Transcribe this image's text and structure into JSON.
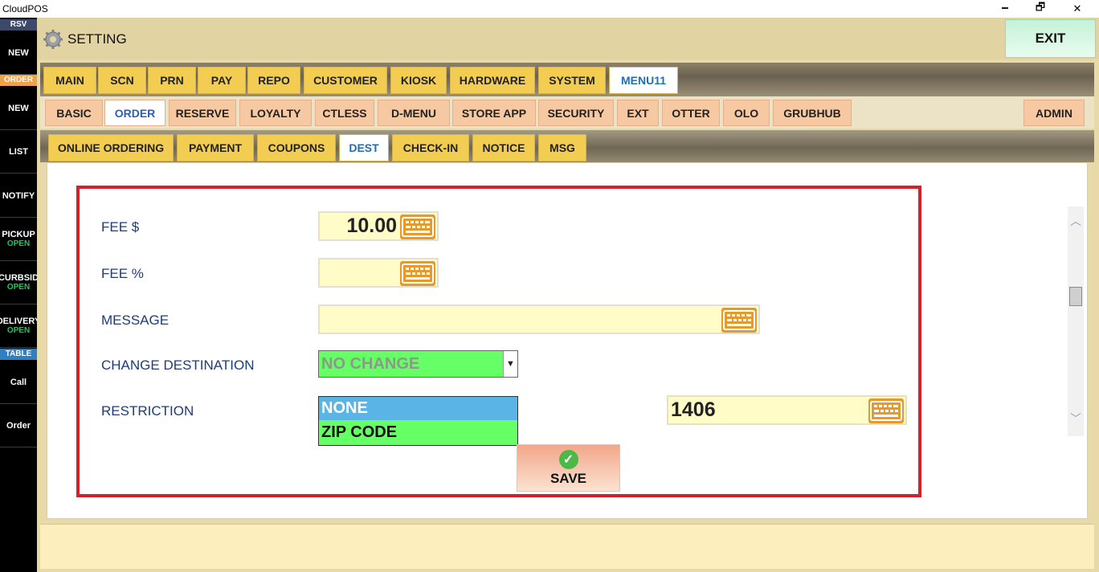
{
  "window": {
    "title": "CloudPOS",
    "minimize": "🗕",
    "restore": "🗗",
    "close": "✕"
  },
  "sidebar": {
    "rsv_header": "RSV",
    "new1": "NEW",
    "order_header": "ORDER",
    "new2": "NEW",
    "list": "LIST",
    "notify": "NOTIFY",
    "pickup": "PICKUP",
    "pickup_status": "OPEN",
    "curbside": "CURBSID",
    "curbside_status": "OPEN",
    "delivery": "DELIVERY",
    "delivery_status": "OPEN",
    "table_header": "TABLE",
    "call": "Call",
    "order": "Order",
    "colors": {
      "rsv": "#3b4a6b",
      "order": "#f0a24a",
      "table": "#2f7fc1",
      "open": "#22c55e"
    }
  },
  "header": {
    "title": "SETTING",
    "exit": "EXIT",
    "icon": "gear-icon"
  },
  "tabs_main": [
    {
      "label": "MAIN"
    },
    {
      "label": "SCN"
    },
    {
      "label": "PRN"
    },
    {
      "label": "PAY"
    },
    {
      "label": "REPO"
    },
    {
      "label": "CUSTOMER"
    },
    {
      "label": "KIOSK"
    },
    {
      "label": "HARDWARE"
    },
    {
      "label": "SYSTEM"
    },
    {
      "label": "MENU11",
      "active": true
    }
  ],
  "tabs_sub": [
    {
      "label": "BASIC"
    },
    {
      "label": "ORDER",
      "active": true
    },
    {
      "label": "RESERVE"
    },
    {
      "label": "LOYALTY"
    },
    {
      "label": "CTLESS"
    },
    {
      "label": "D-MENU"
    },
    {
      "label": "STORE APP"
    },
    {
      "label": "SECURITY"
    },
    {
      "label": "EXT"
    },
    {
      "label": "OTTER"
    },
    {
      "label": "OLO"
    },
    {
      "label": "GRUBHUB"
    },
    {
      "label": "ADMIN"
    }
  ],
  "tabs_order": [
    {
      "label": "ONLINE ORDERING"
    },
    {
      "label": "PAYMENT"
    },
    {
      "label": "COUPONS"
    },
    {
      "label": "DEST",
      "active": true
    },
    {
      "label": "CHECK-IN"
    },
    {
      "label": "NOTICE"
    },
    {
      "label": "MSG"
    }
  ],
  "form": {
    "fee_dollar_label": "FEE $",
    "fee_dollar_value": "10.00",
    "fee_pct_label": "FEE %",
    "fee_pct_value": "",
    "message_label": "MESSAGE",
    "message_value": "",
    "change_dest_label": "CHANGE DESTINATION",
    "change_dest_value": "NO CHANGE",
    "restriction_label": "RESTRICTION",
    "restriction_options": [
      {
        "label": "NONE",
        "selected": true
      },
      {
        "label": "ZIP CODE"
      }
    ],
    "zip_value": "1406",
    "save_label": "SAVE"
  }
}
